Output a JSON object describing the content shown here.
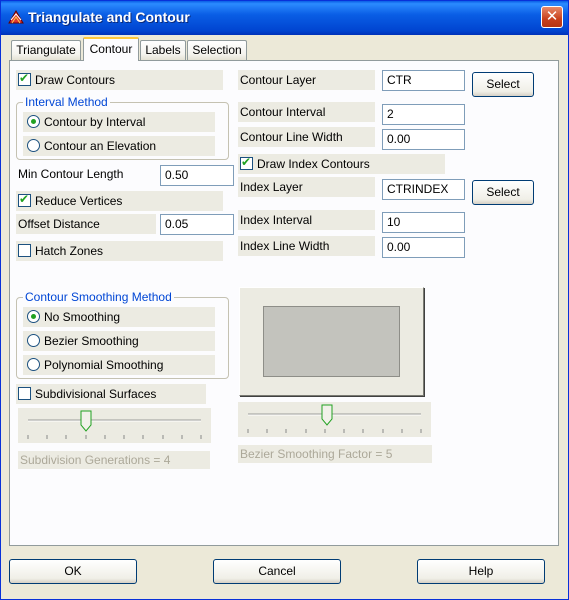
{
  "window": {
    "title": "Triangulate and Contour",
    "close_glyph": "✕"
  },
  "tabs": [
    {
      "label": "Triangulate",
      "active": false
    },
    {
      "label": "Contour",
      "active": true
    },
    {
      "label": "Labels",
      "active": false
    },
    {
      "label": "Selection",
      "active": false
    }
  ],
  "left": {
    "draw_contours": {
      "label": "Draw Contours",
      "checked": true
    },
    "interval_method": {
      "title": "Interval Method",
      "options": [
        {
          "label": "Contour by Interval",
          "selected": true
        },
        {
          "label": "Contour an Elevation",
          "selected": false
        }
      ]
    },
    "min_contour_length": {
      "label": "Min Contour Length",
      "value": "0.50"
    },
    "reduce_vertices": {
      "label": "Reduce Vertices",
      "checked": true
    },
    "offset_distance": {
      "label": "Offset Distance",
      "value": "0.05"
    },
    "hatch_zones": {
      "label": "Hatch Zones",
      "checked": false
    },
    "smoothing_method": {
      "title": "Contour Smoothing Method",
      "options": [
        {
          "label": "No Smoothing",
          "selected": true
        },
        {
          "label": "Bezier Smoothing",
          "selected": false
        },
        {
          "label": "Polynomial Smoothing",
          "selected": false
        }
      ]
    },
    "subdivisional_surfaces": {
      "label": "Subdivisional Surfaces",
      "checked": false
    },
    "subdivision_generations": {
      "label": "Subdivision Generations = 4",
      "value": 4,
      "min": 1,
      "max": 10
    }
  },
  "right": {
    "contour_layer": {
      "label": "Contour Layer",
      "value": "CTR",
      "button": "Select"
    },
    "contour_interval": {
      "label": "Contour Interval",
      "value": "2"
    },
    "contour_line_width": {
      "label": "Contour Line Width",
      "value": "0.00"
    },
    "draw_index_contours": {
      "label": "Draw Index Contours",
      "checked": true
    },
    "index_layer": {
      "label": "Index Layer",
      "value": "CTRINDEX",
      "button": "Select"
    },
    "index_interval": {
      "label": "Index Interval",
      "value": "10"
    },
    "index_line_width": {
      "label": "Index Line Width",
      "value": "0.00"
    },
    "bezier_smoothing_factor": {
      "label": "Bezier Smoothing Factor = 5",
      "value": 5,
      "min": 1,
      "max": 10
    }
  },
  "footer": {
    "ok": "OK",
    "cancel": "Cancel",
    "help": "Help"
  },
  "colors": {
    "title_bar": "#0a5ee5",
    "group_title": "#0046d5",
    "check_mark": "#21a121",
    "preview_fill": "#c3c3bd"
  }
}
